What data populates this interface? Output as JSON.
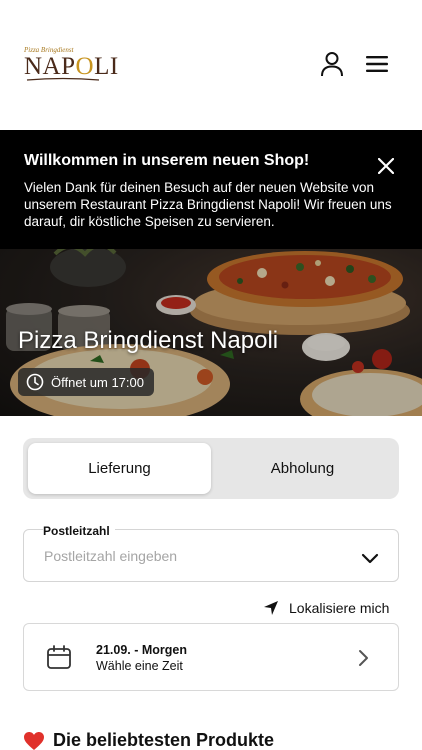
{
  "header": {
    "logo_small": "Pizza Bringdienst",
    "logo_main_pre": "NAP",
    "logo_main_o": "O",
    "logo_main_post": "LI",
    "user_icon": "user-icon",
    "menu_icon": "hamburger-menu-icon"
  },
  "banner": {
    "title": "Willkommen in unserem neuen Shop!",
    "text": "Vielen Dank für deinen Besuch auf der neuen Website von unserem Restaurant Pizza Bringdienst Napoli! Wir freuen uns darauf, dir köstliche Speisen zu servieren.",
    "close_icon": "close-icon"
  },
  "hero": {
    "title": "Pizza Bringdienst Napoli",
    "status": "Öffnet um 17:00",
    "status_icon": "clock-icon"
  },
  "delivery_toggle": {
    "options": [
      "Lieferung",
      "Abholung"
    ],
    "selected": "Lieferung"
  },
  "postcode": {
    "label": "Postleitzahl",
    "placeholder": "Postleitzahl eingeben",
    "value": ""
  },
  "locate": {
    "label": "Lokalisiere mich",
    "icon": "location-arrow-icon"
  },
  "date_picker": {
    "date": "21.09. - Morgen",
    "hint": "Wähle eine Zeit",
    "icon": "calendar-icon"
  },
  "popular": {
    "title": "Die beliebtesten Produkte",
    "icon": "heart-icon"
  },
  "colors": {
    "banner_bg": "#000000",
    "toggle_bg": "#e6e6e6",
    "heart": "#e0312b",
    "logo_brown": "#4a2a1a",
    "logo_gold": "#c8941f"
  }
}
